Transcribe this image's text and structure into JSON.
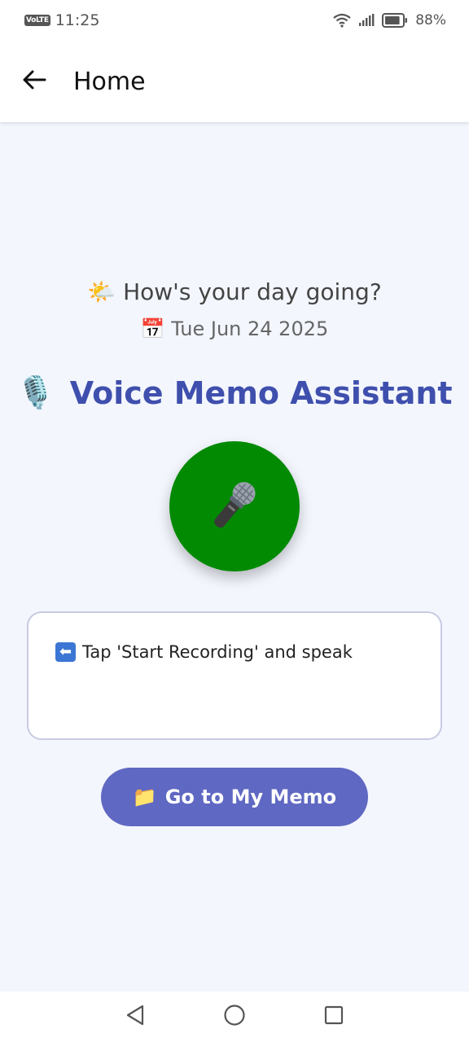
{
  "status_bar": {
    "network_badge": "VoLTE",
    "time": "11:25",
    "battery_percent": "88%",
    "battery_level": 0.88,
    "icons": [
      "wifi-icon",
      "signal-icon",
      "battery-icon"
    ]
  },
  "app_bar": {
    "back_icon": "arrow-left-icon",
    "title": "Home"
  },
  "greeting": {
    "emoji": "🌤️",
    "text": "How's your day going?"
  },
  "date": {
    "emoji": "📅",
    "text": "Tue Jun 24 2025"
  },
  "headline": {
    "emoji": "🎙️",
    "text": "Voice Memo Assistant"
  },
  "record_button": {
    "icon": "microphone-icon",
    "color": "#028a02"
  },
  "transcript": {
    "icon": "left-arrow-icon",
    "icon_glyph": "⬅",
    "text": "Tap 'Start Recording' and speak"
  },
  "memo_button": {
    "emoji": "📁",
    "label": "Go to My Memo",
    "color": "#5f68c2"
  },
  "nav_bar": {
    "icons": [
      "back-triangle-icon",
      "home-circle-icon",
      "recents-square-icon"
    ]
  },
  "colors": {
    "accent": "#3f4fad",
    "background": "#f3f6fd"
  }
}
